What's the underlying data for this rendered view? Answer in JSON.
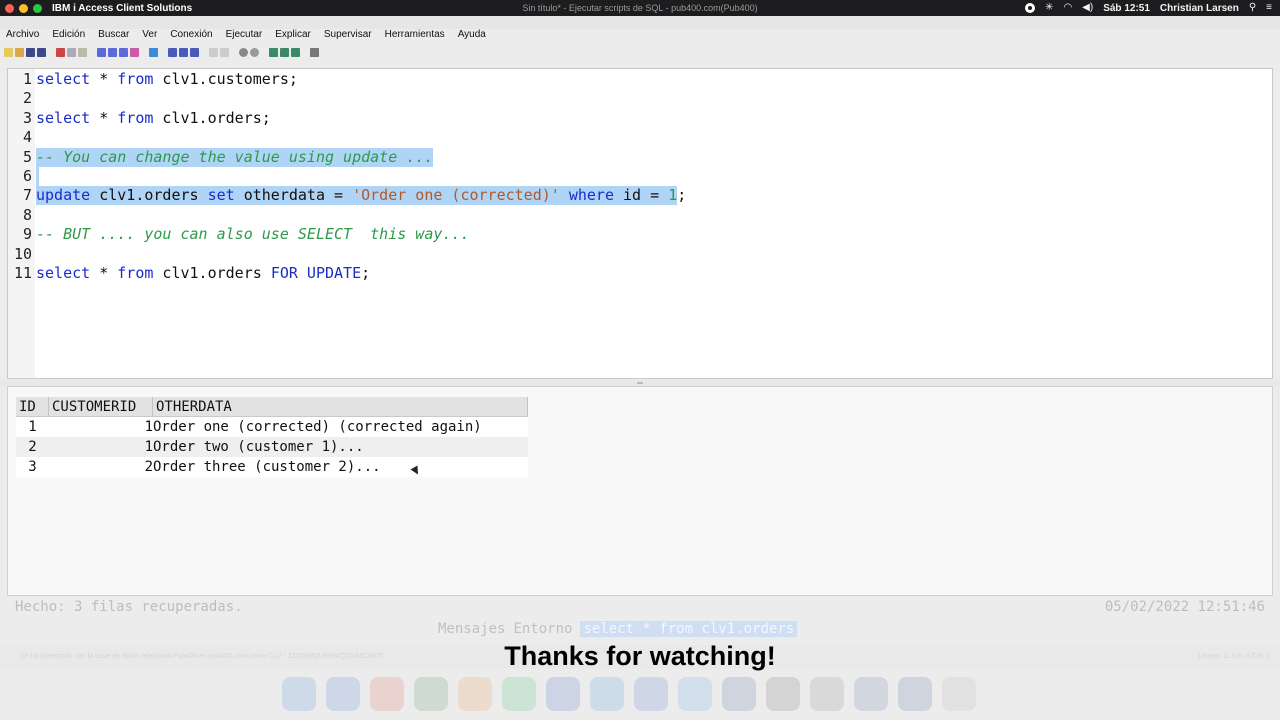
{
  "menubar": {
    "app_name": "IBM i Access Client Solutions",
    "window_title": "Sin título* - Ejecutar scripts de SQL - pub400.com(Pub400)",
    "clock": "Sáb 12:51",
    "user": "Christian Larsen"
  },
  "appmenu": [
    "Archivo",
    "Edición",
    "Buscar",
    "Ver",
    "Conexión",
    "Ejecutar",
    "Explicar",
    "Supervisar",
    "Herramientas",
    "Ayuda"
  ],
  "editor": {
    "lines": [
      {
        "n": "1",
        "parts": [
          {
            "t": "select",
            "c": "kw"
          },
          {
            "t": " * ",
            "c": ""
          },
          {
            "t": "from",
            "c": "kw"
          },
          {
            "t": " clv1.customers;",
            "c": ""
          }
        ]
      },
      {
        "n": "2",
        "parts": []
      },
      {
        "n": "3",
        "parts": [
          {
            "t": "select",
            "c": "kw"
          },
          {
            "t": " * ",
            "c": ""
          },
          {
            "t": "from",
            "c": "kw"
          },
          {
            "t": " clv1.orders;",
            "c": ""
          }
        ]
      },
      {
        "n": "4",
        "parts": []
      },
      {
        "n": "5",
        "parts": [
          {
            "t": "-- You can change the value using update ...",
            "c": "cm"
          }
        ]
      },
      {
        "n": "6",
        "parts": []
      },
      {
        "n": "7",
        "parts": [
          {
            "t": "update",
            "c": "kw"
          },
          {
            "t": " clv1.orders ",
            "c": ""
          },
          {
            "t": "set",
            "c": "kw"
          },
          {
            "t": " otherdata = ",
            "c": ""
          },
          {
            "t": "'Order one (corrected)'",
            "c": "str"
          },
          {
            "t": " ",
            "c": ""
          },
          {
            "t": "where",
            "c": "kw"
          },
          {
            "t": " id = ",
            "c": ""
          },
          {
            "t": "1",
            "c": "num"
          },
          {
            "t": ";",
            "c": "tail"
          }
        ]
      },
      {
        "n": "8",
        "parts": []
      },
      {
        "n": "9",
        "parts": [
          {
            "t": "-- BUT .... you can also use SELECT  this way...",
            "c": "cm"
          }
        ]
      },
      {
        "n": "10",
        "parts": []
      },
      {
        "n": "11",
        "parts": [
          {
            "t": "select",
            "c": "kw"
          },
          {
            "t": " * ",
            "c": ""
          },
          {
            "t": "from",
            "c": "kw"
          },
          {
            "t": " clv1.orders ",
            "c": ""
          },
          {
            "t": "FOR UPDATE",
            "c": "kw"
          },
          {
            "t": ";",
            "c": ""
          }
        ]
      }
    ]
  },
  "results": {
    "columns": [
      "ID",
      "CUSTOMERID",
      "OTHERDATA"
    ],
    "rows": [
      [
        "1",
        "1",
        "Order one (corrected) (corrected again)"
      ],
      [
        "2",
        "1",
        "Order two (customer 1)..."
      ],
      [
        "3",
        "2",
        "Order three (customer 2)..."
      ]
    ]
  },
  "status": {
    "message": "Hecho: 3 filas recuperadas.",
    "timestamp": "05/02/2022 12:51:46"
  },
  "tabs": [
    "Mensajes",
    "Entorno",
    "select * from clv1.orders"
  ],
  "active_tab": "select * from clv1.orders",
  "strip": {
    "left": "Se ha conectado con la base de datos relacional Pub400 en pub400.com como CLV - 322556/QUSER/QZDASOINIT",
    "right": "Líneas: 11 Lín: 5 Col: 1"
  },
  "caption": "Thanks for watching!",
  "colors": {
    "keyword": "#1a2bcc",
    "string": "#b05a2a",
    "comment": "#2d9a4a",
    "selection": "#b0d4f5"
  }
}
